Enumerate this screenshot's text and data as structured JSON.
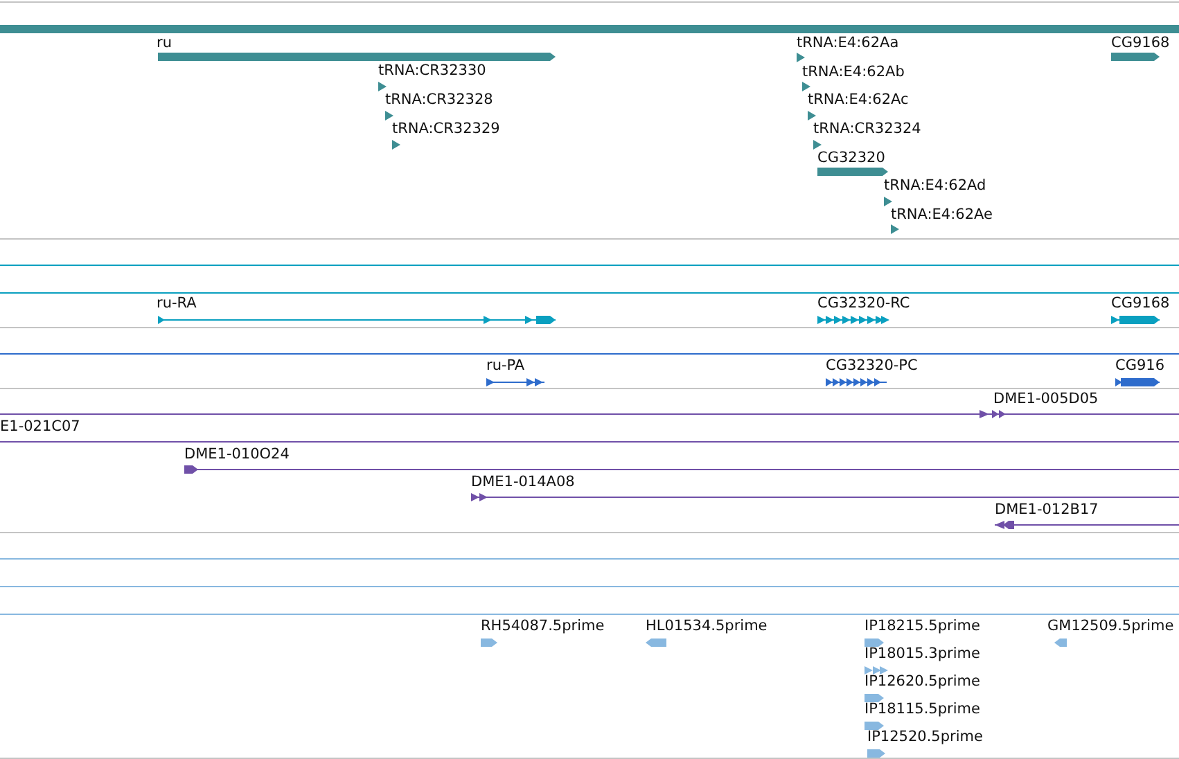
{
  "tracks": [
    {
      "kind": "gene",
      "color": "#3e8e93",
      "features": [
        {
          "label": "ru",
          "kind": "block",
          "reverse": false
        },
        {
          "label": "tRNA:CR32330",
          "kind": "marker",
          "reverse": false
        },
        {
          "label": "tRNA:CR32328",
          "kind": "marker",
          "reverse": false
        },
        {
          "label": "tRNA:CR32329",
          "kind": "marker",
          "reverse": false
        },
        {
          "label": "tRNA:E4:62Aa",
          "kind": "marker",
          "reverse": false
        },
        {
          "label": "tRNA:E4:62Ab",
          "kind": "marker",
          "reverse": false
        },
        {
          "label": "tRNA:E4:62Ac",
          "kind": "marker",
          "reverse": false
        },
        {
          "label": "tRNA:CR32324",
          "kind": "marker",
          "reverse": false
        },
        {
          "label": "CG32320",
          "kind": "block",
          "reverse": false
        },
        {
          "label": "tRNA:E4:62Ad",
          "kind": "marker",
          "reverse": false
        },
        {
          "label": "tRNA:E4:62Ae",
          "kind": "marker",
          "reverse": false
        },
        {
          "label": "CG9168",
          "kind": "block",
          "reverse": false
        }
      ]
    },
    {
      "kind": "transcript",
      "color": "#0aa0c0",
      "features": [
        {
          "label": "ru-RA",
          "kind": "transcript",
          "reverse": false
        },
        {
          "label": "CG32320-RC",
          "kind": "transcript",
          "reverse": false
        },
        {
          "label": "CG9168",
          "kind": "transcript",
          "reverse": false
        }
      ]
    },
    {
      "kind": "protein",
      "color": "#2e6ccc",
      "features": [
        {
          "label": "ru-PA",
          "kind": "transcript",
          "reverse": false
        },
        {
          "label": "CG32320-PC",
          "kind": "transcript",
          "reverse": false
        },
        {
          "label": "CG916",
          "kind": "transcript",
          "reverse": false
        }
      ]
    },
    {
      "kind": "clone",
      "color": "#7050a8",
      "features": [
        {
          "label": "DME1-005D05",
          "kind": "span",
          "reverse": false
        },
        {
          "label": "E1-021C07",
          "kind": "span"
        },
        {
          "label": "DME1-010O24",
          "kind": "span",
          "reverse": false
        },
        {
          "label": "DME1-014A08",
          "kind": "span",
          "reverse": false
        },
        {
          "label": "DME1-012B17",
          "kind": "span",
          "reverse": true
        }
      ]
    },
    {
      "kind": "est",
      "color": "#88b8e0",
      "features": [
        {
          "label": "RH54087.5prime",
          "kind": "est",
          "reverse": false
        },
        {
          "label": "HL01534.5prime",
          "kind": "est",
          "reverse": true
        },
        {
          "label": "IP18215.5prime",
          "kind": "est",
          "reverse": false
        },
        {
          "label": "IP18015.3prime",
          "kind": "est",
          "reverse": false
        },
        {
          "label": "IP12620.5prime",
          "kind": "est",
          "reverse": false
        },
        {
          "label": "IP18115.5prime",
          "kind": "est",
          "reverse": false
        },
        {
          "label": "IP12520.5prime",
          "kind": "est",
          "reverse": false
        },
        {
          "label": "GM12509.5prime",
          "kind": "est",
          "reverse": true
        }
      ]
    }
  ]
}
